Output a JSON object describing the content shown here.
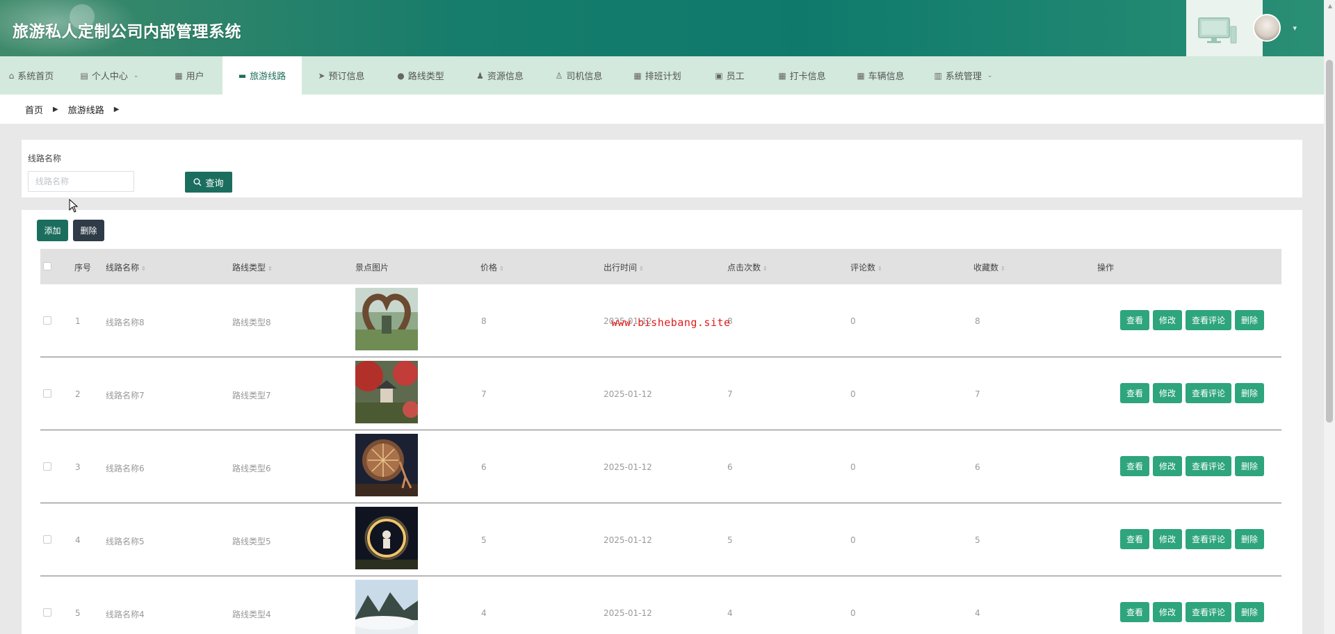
{
  "header": {
    "title": "旅游私人定制公司内部管理系统",
    "icons": [
      "monitor-icon",
      "avatar"
    ]
  },
  "nav": {
    "items": [
      {
        "label": "系统首页",
        "icon": "home-icon",
        "glyph": "⌂",
        "width": 90
      },
      {
        "label": "个人中心",
        "icon": "calendar-icon",
        "glyph": "▤",
        "width": 135,
        "caret": true
      },
      {
        "label": "用户",
        "icon": "grid-icon",
        "glyph": "▦",
        "width": 95
      },
      {
        "label": "旅游线路",
        "icon": "briefcase-icon",
        "glyph": "▬",
        "width": 114,
        "active": true
      },
      {
        "label": "预订信息",
        "icon": "send-icon",
        "glyph": "➤",
        "width": 114
      },
      {
        "label": "路线类型",
        "icon": "location-icon",
        "glyph": "●",
        "width": 114
      },
      {
        "label": "资源信息",
        "icon": "user-icon",
        "glyph": "♟",
        "width": 114
      },
      {
        "label": "司机信息",
        "icon": "person-icon",
        "glyph": "♙",
        "width": 113
      },
      {
        "label": "排班计划",
        "icon": "grid-icon",
        "glyph": "▦",
        "width": 113
      },
      {
        "label": "员工",
        "icon": "clipboard-icon",
        "glyph": "▣",
        "width": 95
      },
      {
        "label": "打卡信息",
        "icon": "grid-icon",
        "glyph": "▦",
        "width": 113
      },
      {
        "label": "车辆信息",
        "icon": "grid-icon",
        "glyph": "▦",
        "width": 113
      },
      {
        "label": "系统管理",
        "icon": "chart-icon",
        "glyph": "▥",
        "width": 125,
        "caret": true
      }
    ]
  },
  "breadcrumb": {
    "home": "首页",
    "current": "旅游线路"
  },
  "search": {
    "label": "线路名称",
    "placeholder": "线路名称",
    "button": "查询"
  },
  "toolbar": {
    "add": "添加",
    "delete": "删除"
  },
  "table": {
    "headers": {
      "index": "序号",
      "name": "线路名称",
      "type": "路线类型",
      "image": "景点图片",
      "price": "价格",
      "date": "出行时间",
      "clicks": "点击次数",
      "comments": "评论数",
      "favorites": "收藏数",
      "actions": "操作"
    },
    "rows": [
      {
        "index": "1",
        "name": "线路名称8",
        "type": "路线类型8",
        "price": "8",
        "date": "2025-01-12",
        "clicks": "8",
        "comments": "0",
        "favorites": "8",
        "img": "heart"
      },
      {
        "index": "2",
        "name": "线路名称7",
        "type": "路线类型7",
        "price": "7",
        "date": "2025-01-12",
        "clicks": "7",
        "comments": "0",
        "favorites": "7",
        "img": "pavilion"
      },
      {
        "index": "3",
        "name": "线路名称6",
        "type": "路线类型6",
        "price": "6",
        "date": "2025-01-12",
        "clicks": "6",
        "comments": "0",
        "favorites": "6",
        "img": "lantern"
      },
      {
        "index": "4",
        "name": "线路名称5",
        "type": "路线类型5",
        "price": "5",
        "date": "2025-01-12",
        "clicks": "5",
        "comments": "0",
        "favorites": "5",
        "img": "ring"
      },
      {
        "index": "5",
        "name": "线路名称4",
        "type": "路线类型4",
        "price": "4",
        "date": "2025-01-12",
        "clicks": "4",
        "comments": "0",
        "favorites": "4",
        "img": "mountain"
      }
    ],
    "actions": {
      "view": "查看",
      "edit": "修改",
      "comments": "查看评论",
      "delete": "删除"
    }
  },
  "watermark": "www.bishebang.site",
  "colors": {
    "primary": "#1b6e5e",
    "action": "#2ea57c",
    "nav_bg": "#d3e9dd",
    "dark_button": "#2f3b47"
  }
}
